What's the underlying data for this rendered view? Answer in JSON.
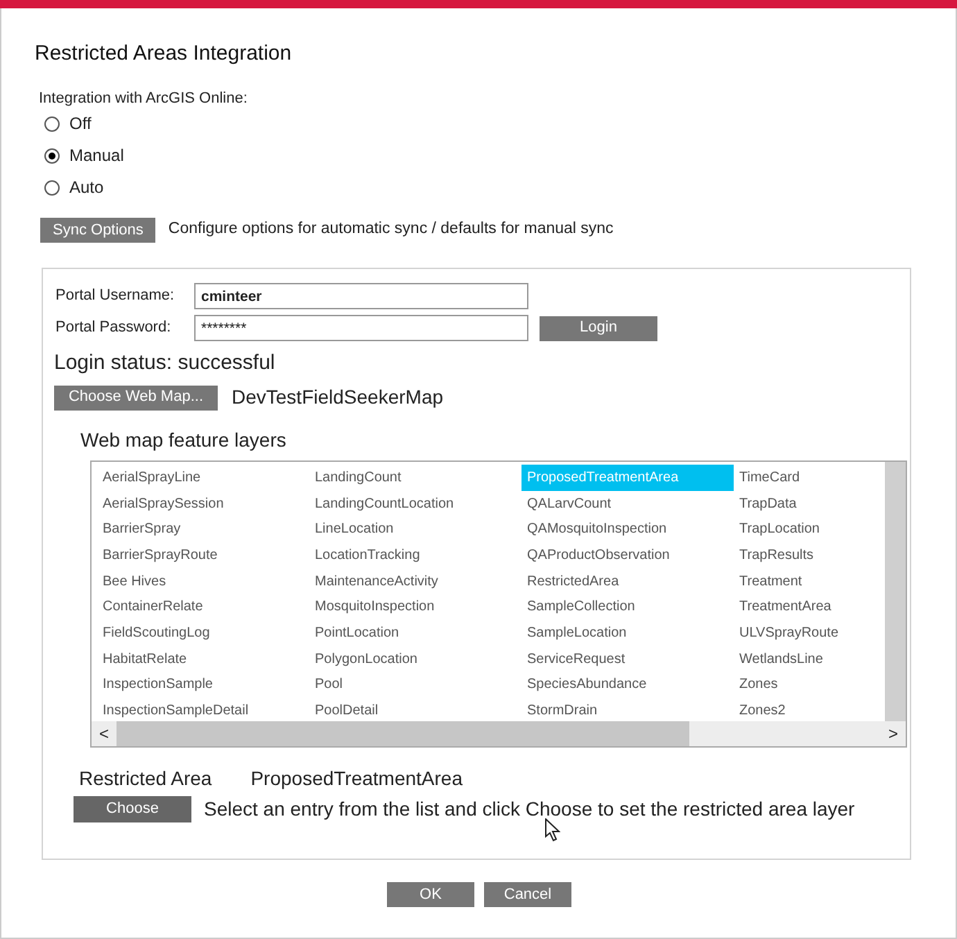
{
  "title": "Restricted Areas Integration",
  "integration": {
    "label": "Integration with ArcGIS Online:",
    "options": [
      {
        "label": "Off",
        "selected": false
      },
      {
        "label": "Manual",
        "selected": true
      },
      {
        "label": "Auto",
        "selected": false
      }
    ]
  },
  "sync": {
    "button": "Sync Options",
    "description": "Configure options for automatic sync / defaults for manual sync"
  },
  "portal": {
    "username_label": "Portal Username:",
    "username": "cminteer",
    "password_label": "Portal Password:",
    "password": "********",
    "login_button": "Login",
    "status": "Login status: successful",
    "webmap_button": "Choose Web Map...",
    "webmap": "DevTestFieldSeekerMap"
  },
  "layers": {
    "heading": "Web map feature layers",
    "items": [
      {
        "label": "AerialSprayLine",
        "selected": false
      },
      {
        "label": "AerialSpraySession",
        "selected": false
      },
      {
        "label": "BarrierSpray",
        "selected": false
      },
      {
        "label": "BarrierSprayRoute",
        "selected": false
      },
      {
        "label": "Bee Hives",
        "selected": false
      },
      {
        "label": "ContainerRelate",
        "selected": false
      },
      {
        "label": "FieldScoutingLog",
        "selected": false
      },
      {
        "label": "HabitatRelate",
        "selected": false
      },
      {
        "label": "InspectionSample",
        "selected": false
      },
      {
        "label": "InspectionSampleDetail",
        "selected": false
      },
      {
        "label": "LandingCount",
        "selected": false
      },
      {
        "label": "LandingCountLocation",
        "selected": false
      },
      {
        "label": "LineLocation",
        "selected": false
      },
      {
        "label": "LocationTracking",
        "selected": false
      },
      {
        "label": "MaintenanceActivity",
        "selected": false
      },
      {
        "label": "MosquitoInspection",
        "selected": false
      },
      {
        "label": "PointLocation",
        "selected": false
      },
      {
        "label": "PolygonLocation",
        "selected": false
      },
      {
        "label": "Pool",
        "selected": false
      },
      {
        "label": "PoolDetail",
        "selected": false
      },
      {
        "label": "ProposedTreatmentArea",
        "selected": true
      },
      {
        "label": "QALarvCount",
        "selected": false
      },
      {
        "label": "QAMosquitoInspection",
        "selected": false
      },
      {
        "label": "QAProductObservation",
        "selected": false
      },
      {
        "label": "RestrictedArea",
        "selected": false
      },
      {
        "label": "SampleCollection",
        "selected": false
      },
      {
        "label": "SampleLocation",
        "selected": false
      },
      {
        "label": "ServiceRequest",
        "selected": false
      },
      {
        "label": "SpeciesAbundance",
        "selected": false
      },
      {
        "label": "StormDrain",
        "selected": false
      },
      {
        "label": "TimeCard",
        "selected": false
      },
      {
        "label": "TrapData",
        "selected": false
      },
      {
        "label": "TrapLocation",
        "selected": false
      },
      {
        "label": "TrapResults",
        "selected": false
      },
      {
        "label": "Treatment",
        "selected": false
      },
      {
        "label": "TreatmentArea",
        "selected": false
      },
      {
        "label": "ULVSprayRoute",
        "selected": false
      },
      {
        "label": "WetlandsLine",
        "selected": false
      },
      {
        "label": "Zones",
        "selected": false
      },
      {
        "label": "Zones2",
        "selected": false
      }
    ],
    "scroll_left": "<",
    "scroll_right": ">"
  },
  "restricted": {
    "label": "Restricted Area",
    "value": "ProposedTreatmentArea",
    "button": "Choose",
    "hint": "Select an entry from the list and click Choose to set the restricted area layer"
  },
  "buttons": [
    "OK",
    "Cancel"
  ]
}
